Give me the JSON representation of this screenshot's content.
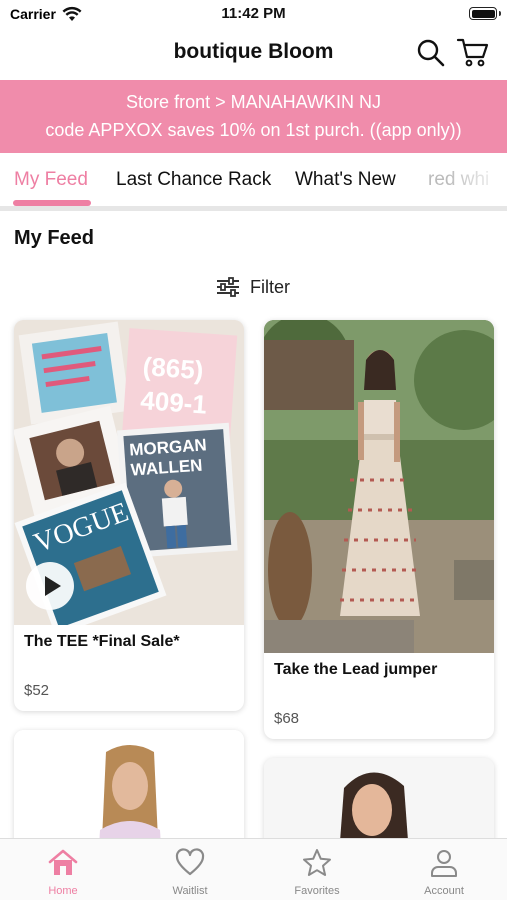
{
  "status_bar": {
    "carrier": "Carrier",
    "time": "11:42 PM"
  },
  "header": {
    "title": "boutique Bloom",
    "search_icon": "search-icon",
    "cart_icon": "cart-icon"
  },
  "banner": {
    "line1": "Store front > MANAHAWKIN NJ",
    "line2": "code APPXOX saves 10% on 1st purch. ((app only))",
    "background": "#f08cab"
  },
  "tabs": [
    {
      "label": "My Feed",
      "active": true
    },
    {
      "label": "Last Chance Rack",
      "active": false
    },
    {
      "label": "What's New",
      "active": false
    },
    {
      "label": "red whi",
      "active": false
    }
  ],
  "section_title": "My Feed",
  "filter": {
    "label": "Filter",
    "icon": "sliders-icon"
  },
  "products": [
    {
      "name": "The TEE *Final Sale*",
      "price": "$52",
      "has_video": true,
      "magazine_texts": [
        "MORGAN",
        "WALLEN",
        "VOGUE",
        "(865)",
        "409-1"
      ]
    },
    {
      "name": "Take the Lead jumper",
      "price": "$68",
      "has_video": false
    },
    {
      "name": "",
      "price": ""
    },
    {
      "name": "",
      "price": ""
    }
  ],
  "bottom_nav": [
    {
      "label": "Home",
      "icon": "home-icon",
      "active": true
    },
    {
      "label": "Waitlist",
      "icon": "heart-icon",
      "active": false
    },
    {
      "label": "Favorites",
      "icon": "star-icon",
      "active": false
    },
    {
      "label": "Account",
      "icon": "account-icon",
      "active": false
    }
  ],
  "colors": {
    "accent": "#ee7fa3",
    "banner": "#f08cab"
  }
}
